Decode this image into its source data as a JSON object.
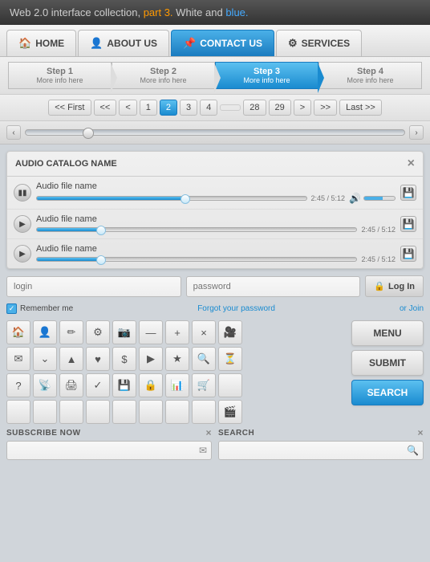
{
  "header": {
    "text_normal": "Web 2.0 interface collection,",
    "text_orange": "part 3.",
    "text_white": "White and",
    "text_blue": "blue."
  },
  "nav": {
    "items": [
      {
        "id": "home",
        "label": "HOME",
        "icon": "🏠",
        "active": false
      },
      {
        "id": "about",
        "label": "ABOUT US",
        "icon": "👤",
        "active": false
      },
      {
        "id": "contact",
        "label": "CONTACT US",
        "icon": "📌",
        "active": true
      },
      {
        "id": "services",
        "label": "SERVICES",
        "icon": "⚙",
        "active": false
      }
    ]
  },
  "steps": [
    {
      "title": "Step 1",
      "sub": "More info here",
      "active": false
    },
    {
      "title": "Step 2",
      "sub": "More info here",
      "active": false
    },
    {
      "title": "Step 3",
      "sub": "More info here",
      "active": true
    },
    {
      "title": "Step 4",
      "sub": "More info here",
      "active": false
    }
  ],
  "pagination": {
    "first": "<< First",
    "prev2": "<<",
    "prev1": "<",
    "pages": [
      "1",
      "2",
      "3",
      "4",
      "",
      "28",
      "29"
    ],
    "active_page": "2",
    "next1": ">",
    "next2": ">>",
    "last": "Last >>"
  },
  "audio": {
    "catalog_name": "AUDIO CATALOG NAME",
    "close_label": "×",
    "tracks": [
      {
        "name": "Audio file name",
        "time_current": "2:45",
        "time_total": "5:12",
        "progress": 55,
        "playing": true
      },
      {
        "name": "Audio file name",
        "time_current": "2:45",
        "time_total": "5:12",
        "progress": 20,
        "playing": false
      },
      {
        "name": "Audio file name",
        "time_current": "2:45",
        "time_total": "5:12",
        "progress": 20,
        "playing": false
      }
    ]
  },
  "login": {
    "username_placeholder": "login",
    "password_placeholder": "password",
    "login_btn": "Log In",
    "login_icon": "🔒",
    "remember_label": "Remember me",
    "forgot_label": "Forgot your password",
    "join_label": "or Join"
  },
  "icons": {
    "cells": [
      "🏠",
      "👤",
      "✏",
      "⚙",
      "📷",
      "—",
      "+",
      "×",
      "🎥",
      "✉",
      "⌄",
      "▲",
      "♥",
      "$",
      ">",
      "★",
      "🔍",
      "⏳",
      "?",
      "📡",
      "🖨",
      "✓",
      "💾",
      "🔒",
      "📊",
      "🛒",
      "",
      "",
      "",
      "",
      "",
      "",
      "",
      "",
      "",
      "🎬"
    ]
  },
  "right_buttons": {
    "menu": "MENU",
    "submit": "SUBMIT",
    "search": "SEARCH"
  },
  "bottom_fields": [
    {
      "label": "SUBSCRIBE NOW",
      "placeholder": "",
      "icon": "✉",
      "has_x": true
    },
    {
      "label": "SEARCH",
      "placeholder": "",
      "icon": "🔍",
      "has_x": true
    }
  ]
}
